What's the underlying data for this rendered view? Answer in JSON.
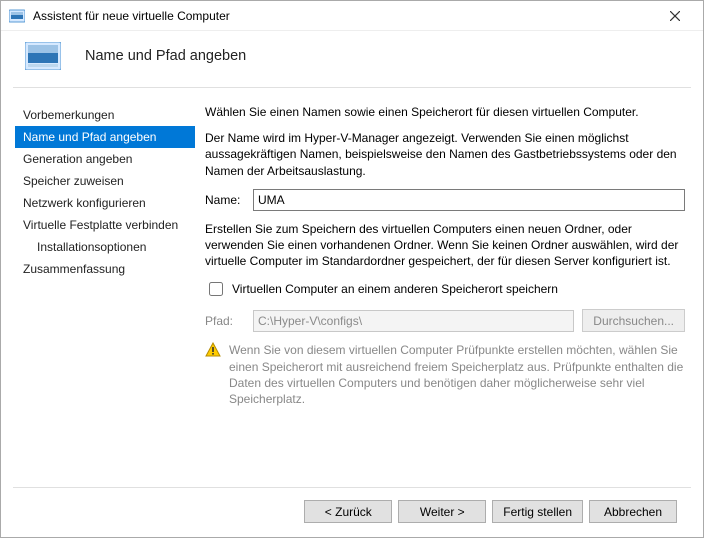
{
  "window": {
    "title": "Assistent für neue virtuelle Computer"
  },
  "header": {
    "page_title": "Name und Pfad angeben"
  },
  "sidebar": {
    "steps": [
      {
        "label": "Vorbemerkungen",
        "selected": false,
        "sub": false
      },
      {
        "label": "Name und Pfad angeben",
        "selected": true,
        "sub": false
      },
      {
        "label": "Generation angeben",
        "selected": false,
        "sub": false
      },
      {
        "label": "Speicher zuweisen",
        "selected": false,
        "sub": false
      },
      {
        "label": "Netzwerk konfigurieren",
        "selected": false,
        "sub": false
      },
      {
        "label": "Virtuelle Festplatte verbinden",
        "selected": false,
        "sub": false
      },
      {
        "label": "Installationsoptionen",
        "selected": false,
        "sub": true
      },
      {
        "label": "Zusammenfassung",
        "selected": false,
        "sub": false
      }
    ]
  },
  "content": {
    "intro": "Wählen Sie einen Namen sowie einen Speicherort für diesen virtuellen Computer.",
    "help": "Der Name wird im Hyper-V-Manager angezeigt. Verwenden Sie einen möglichst aussagekräftigen Namen, beispielsweise den Namen des Gastbetriebssystems oder den Namen der Arbeitsauslastung.",
    "name_label": "Name:",
    "name_value": "UMA",
    "location_help": "Erstellen Sie zum Speichern des virtuellen Computers einen neuen Ordner, oder verwenden Sie einen vorhandenen Ordner. Wenn Sie keinen Ordner auswählen, wird der virtuelle Computer im Standardordner gespeichert, der für diesen Server konfiguriert ist.",
    "checkbox_label": "Virtuellen Computer an einem anderen Speicherort speichern",
    "path_label": "Pfad:",
    "path_value": "C:\\Hyper-V\\configs\\",
    "browse_label": "Durchsuchen...",
    "warning": "Wenn Sie von diesem virtuellen Computer Prüfpunkte erstellen möchten, wählen Sie einen Speicherort mit ausreichend freiem Speicherplatz aus. Prüfpunkte enthalten die Daten des virtuellen Computers und benötigen daher möglicherweise sehr viel Speicherplatz."
  },
  "footer": {
    "back": "< Zurück",
    "next": "Weiter >",
    "finish": "Fertig stellen",
    "cancel": "Abbrechen"
  }
}
